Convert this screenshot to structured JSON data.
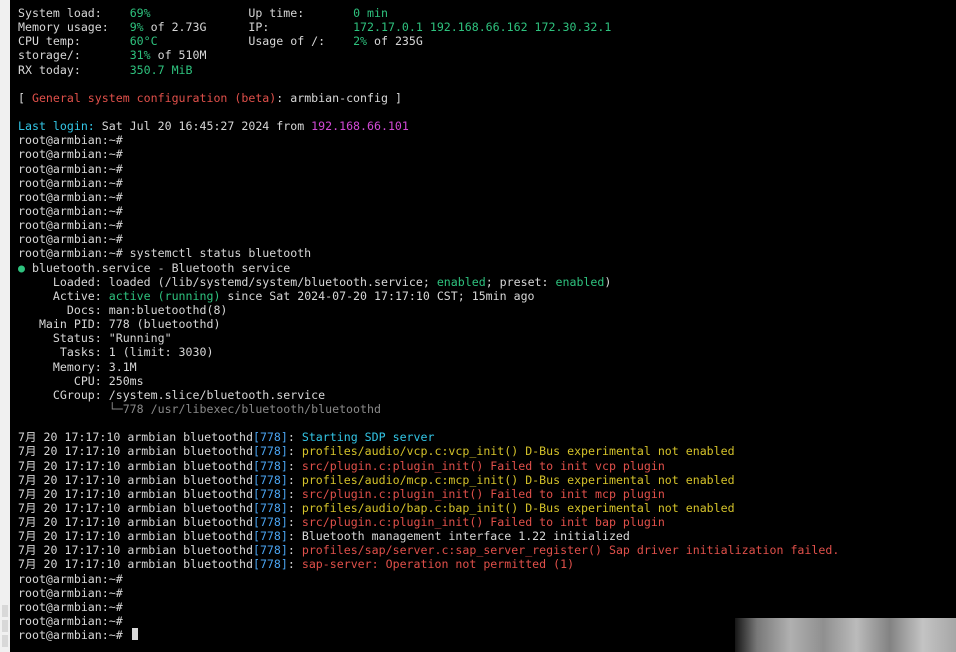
{
  "colors": {
    "default": "#d7d7d7",
    "green": "#2ec27e",
    "red": "#e0504a",
    "yellow": "#d4c22a",
    "cyan": "#33c6e6",
    "blue": "#4aa3f0",
    "magenta": "#d24ad6",
    "gray": "#8a8a8a"
  },
  "terminal": {
    "lines": [
      [
        {
          "t": "System load:    ",
          "c": "default"
        },
        {
          "t": "69%",
          "c": "green"
        },
        {
          "t": "              Up time:       ",
          "c": "default"
        },
        {
          "t": "0 min",
          "c": "green"
        }
      ],
      [
        {
          "t": "Memory usage:   ",
          "c": "default"
        },
        {
          "t": "9%",
          "c": "green"
        },
        {
          "t": " of 2.73G      IP:            ",
          "c": "default"
        },
        {
          "t": "172.17.0.1 192.168.66.162 172.30.32.1",
          "c": "green"
        }
      ],
      [
        {
          "t": "CPU temp:       ",
          "c": "default"
        },
        {
          "t": "60°C",
          "c": "green"
        },
        {
          "t": "             Usage of /:    ",
          "c": "default"
        },
        {
          "t": "2%",
          "c": "green"
        },
        {
          "t": " of 235G",
          "c": "default"
        }
      ],
      [
        {
          "t": "storage/:       ",
          "c": "default"
        },
        {
          "t": "31%",
          "c": "green"
        },
        {
          "t": " of 510M",
          "c": "default"
        }
      ],
      [
        {
          "t": "RX today:       ",
          "c": "default"
        },
        {
          "t": "350.7 MiB",
          "c": "green"
        }
      ],
      [],
      [
        {
          "t": "[ ",
          "c": "default"
        },
        {
          "t": "General system configuration (beta)",
          "c": "red"
        },
        {
          "t": ": armbian-config ]",
          "c": "default"
        }
      ],
      [],
      [
        {
          "t": "Last login:",
          "c": "cyan"
        },
        {
          "t": " Sat Jul 20 16:45:27 2024 from ",
          "c": "default"
        },
        {
          "t": "192.168.66.101",
          "c": "magenta"
        }
      ],
      [
        {
          "t": "root@armbian:~#",
          "c": "default"
        }
      ],
      [
        {
          "t": "root@armbian:~#",
          "c": "default"
        }
      ],
      [
        {
          "t": "root@armbian:~#",
          "c": "default"
        }
      ],
      [
        {
          "t": "root@armbian:~#",
          "c": "default"
        }
      ],
      [
        {
          "t": "root@armbian:~#",
          "c": "default"
        }
      ],
      [
        {
          "t": "root@armbian:~#",
          "c": "default"
        }
      ],
      [
        {
          "t": "root@armbian:~#",
          "c": "default"
        }
      ],
      [
        {
          "t": "root@armbian:~#",
          "c": "default"
        }
      ],
      [
        {
          "t": "root@armbian:~# systemctl status bluetooth",
          "c": "default"
        }
      ],
      [
        {
          "t": "●",
          "c": "green"
        },
        {
          "t": " bluetooth.service - Bluetooth service",
          "c": "default"
        }
      ],
      [
        {
          "t": "     Loaded: loaded (/lib/systemd/system/bluetooth.service; ",
          "c": "default"
        },
        {
          "t": "enabled",
          "c": "green"
        },
        {
          "t": "; preset: ",
          "c": "default"
        },
        {
          "t": "enabled",
          "c": "green"
        },
        {
          "t": ")",
          "c": "default"
        }
      ],
      [
        {
          "t": "     Active: ",
          "c": "default"
        },
        {
          "t": "active (running)",
          "c": "green"
        },
        {
          "t": " since Sat 2024-07-20 17:17:10 CST; 15min ago",
          "c": "default"
        }
      ],
      [
        {
          "t": "       Docs: man:bluetoothd(8)",
          "c": "default"
        }
      ],
      [
        {
          "t": "   Main PID: 778 (bluetoothd)",
          "c": "default"
        }
      ],
      [
        {
          "t": "     Status: \"Running\"",
          "c": "default"
        }
      ],
      [
        {
          "t": "      Tasks: 1 (limit: 3030)",
          "c": "default"
        }
      ],
      [
        {
          "t": "     Memory: 3.1M",
          "c": "default"
        }
      ],
      [
        {
          "t": "        CPU: 250ms",
          "c": "default"
        }
      ],
      [
        {
          "t": "     CGroup: /system.slice/bluetooth.service",
          "c": "default"
        }
      ],
      [
        {
          "t": "             └─778 /usr/libexec/bluetooth/bluetoothd",
          "c": "gray"
        }
      ],
      [],
      [
        {
          "t": "7月 20 17:17:10 armbian bluetoothd",
          "c": "default"
        },
        {
          "t": "[778]",
          "c": "blue"
        },
        {
          "t": ": ",
          "c": "default"
        },
        {
          "t": "Starting SDP server",
          "c": "cyan"
        }
      ],
      [
        {
          "t": "7月 20 17:17:10 armbian bluetoothd",
          "c": "default"
        },
        {
          "t": "[778]",
          "c": "blue"
        },
        {
          "t": ": ",
          "c": "default"
        },
        {
          "t": "profiles/audio/vcp.c:vcp_init() D-Bus experimental not enabled",
          "c": "yellow"
        }
      ],
      [
        {
          "t": "7月 20 17:17:10 armbian bluetoothd",
          "c": "default"
        },
        {
          "t": "[778]",
          "c": "blue"
        },
        {
          "t": ": ",
          "c": "default"
        },
        {
          "t": "src/plugin.c:plugin_init() Failed to init vcp plugin",
          "c": "red"
        }
      ],
      [
        {
          "t": "7月 20 17:17:10 armbian bluetoothd",
          "c": "default"
        },
        {
          "t": "[778]",
          "c": "blue"
        },
        {
          "t": ": ",
          "c": "default"
        },
        {
          "t": "profiles/audio/mcp.c:mcp_init() D-Bus experimental not enabled",
          "c": "yellow"
        }
      ],
      [
        {
          "t": "7月 20 17:17:10 armbian bluetoothd",
          "c": "default"
        },
        {
          "t": "[778]",
          "c": "blue"
        },
        {
          "t": ": ",
          "c": "default"
        },
        {
          "t": "src/plugin.c:plugin_init() Failed to init mcp plugin",
          "c": "red"
        }
      ],
      [
        {
          "t": "7月 20 17:17:10 armbian bluetoothd",
          "c": "default"
        },
        {
          "t": "[778]",
          "c": "blue"
        },
        {
          "t": ": ",
          "c": "default"
        },
        {
          "t": "profiles/audio/bap.c:bap_init() D-Bus experimental not enabled",
          "c": "yellow"
        }
      ],
      [
        {
          "t": "7月 20 17:17:10 armbian bluetoothd",
          "c": "default"
        },
        {
          "t": "[778]",
          "c": "blue"
        },
        {
          "t": ": ",
          "c": "default"
        },
        {
          "t": "src/plugin.c:plugin_init() Failed to init bap plugin",
          "c": "red"
        }
      ],
      [
        {
          "t": "7月 20 17:17:10 armbian bluetoothd",
          "c": "default"
        },
        {
          "t": "[778]",
          "c": "blue"
        },
        {
          "t": ": Bluetooth management interface 1.22 initialized",
          "c": "default"
        }
      ],
      [
        {
          "t": "7月 20 17:17:10 armbian bluetoothd",
          "c": "default"
        },
        {
          "t": "[778]",
          "c": "blue"
        },
        {
          "t": ": ",
          "c": "default"
        },
        {
          "t": "profiles/sap/server.c:sap_server_register() Sap driver initialization failed.",
          "c": "red"
        }
      ],
      [
        {
          "t": "7月 20 17:17:10 armbian bluetoothd",
          "c": "default"
        },
        {
          "t": "[778]",
          "c": "blue"
        },
        {
          "t": ": ",
          "c": "default"
        },
        {
          "t": "sap-server: Operation not permitted (1)",
          "c": "red"
        }
      ],
      [
        {
          "t": "root@armbian:~#",
          "c": "default"
        }
      ],
      [
        {
          "t": "root@armbian:~#",
          "c": "default"
        }
      ],
      [
        {
          "t": "root@armbian:~#",
          "c": "default"
        }
      ],
      [
        {
          "t": "root@armbian:~#",
          "c": "default"
        }
      ],
      [
        {
          "t": "root@armbian:~# ",
          "c": "default"
        }
      ]
    ]
  }
}
